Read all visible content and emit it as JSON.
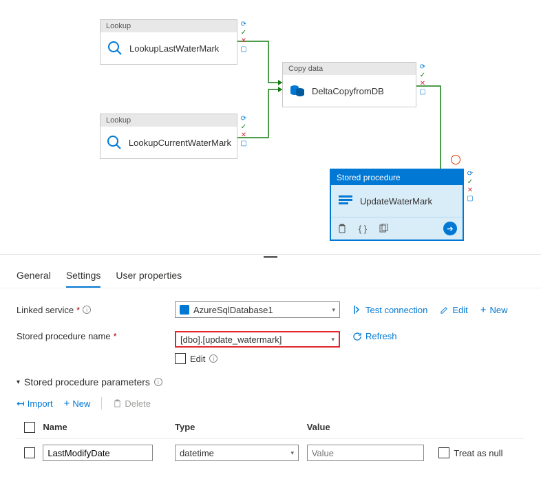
{
  "canvas": {
    "activities": {
      "lookup1": {
        "type": "Lookup",
        "name": "LookupLastWaterMark"
      },
      "lookup2": {
        "type": "Lookup",
        "name": "LookupCurrentWaterMark"
      },
      "copy": {
        "type": "Copy data",
        "name": "DeltaCopyfromDB"
      },
      "sproc": {
        "type": "Stored procedure",
        "name": "UpdateWaterMark"
      }
    }
  },
  "tabs": {
    "general": "General",
    "settings": "Settings",
    "userprops": "User properties"
  },
  "form": {
    "linked_service_label": "Linked service",
    "linked_service_value": "AzureSqlDatabase1",
    "test_connection": "Test connection",
    "edit": "Edit",
    "new": "New",
    "sproc_label": "Stored procedure name",
    "sproc_value": "[dbo].[update_watermark]",
    "refresh": "Refresh",
    "edit_checkbox": "Edit",
    "params_header": "Stored procedure parameters",
    "import": "Import",
    "new_btn": "New",
    "delete": "Delete"
  },
  "table": {
    "headers": {
      "name": "Name",
      "type": "Type",
      "value": "Value"
    },
    "row": {
      "name": "LastModifyDate",
      "type": "datetime",
      "value_placeholder": "Value",
      "treat_null": "Treat as null"
    }
  }
}
